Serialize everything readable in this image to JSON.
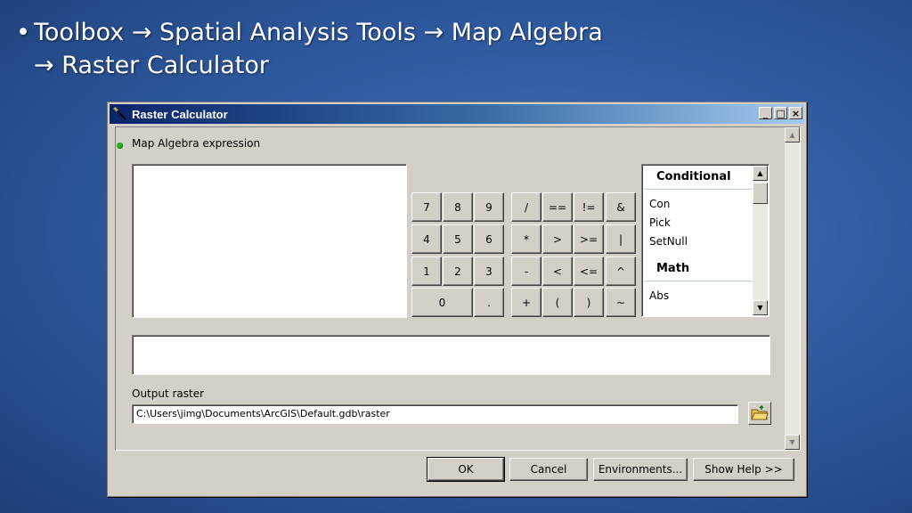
{
  "slide": {
    "bullet": "•",
    "line1": "Toolbox → Spatial Analysis Tools → Map Algebra",
    "line2": "→ Raster Calculator"
  },
  "window": {
    "title": "Raster Calculator",
    "controls": {
      "minimize": "_",
      "maximize": "□",
      "close": "×"
    }
  },
  "expression": {
    "label": "Map Algebra expression",
    "value": ""
  },
  "keypad": [
    [
      "7",
      "8",
      "9",
      "/",
      "==",
      "!=",
      "&"
    ],
    [
      "4",
      "5",
      "6",
      "*",
      ">",
      ">=",
      "|"
    ],
    [
      "1",
      "2",
      "3",
      "-",
      "<",
      "<=",
      "^"
    ],
    [
      "0",
      ".",
      "+",
      "(",
      ")",
      "~"
    ]
  ],
  "functions": {
    "categories": [
      {
        "name": "Conditional",
        "items": [
          "Con",
          "Pick",
          "SetNull"
        ]
      },
      {
        "name": "Math",
        "items": [
          "Abs"
        ]
      }
    ]
  },
  "output": {
    "label": "Output raster",
    "value": "C:\\Users\\jimg\\Documents\\ArcGIS\\Default.gdb\\raster"
  },
  "buttons": {
    "ok": "OK",
    "cancel": "Cancel",
    "environments": "Environments...",
    "show_help": "Show Help >>"
  },
  "icons": {
    "app": "raster-calculator-icon",
    "folder": "open-folder-icon"
  }
}
